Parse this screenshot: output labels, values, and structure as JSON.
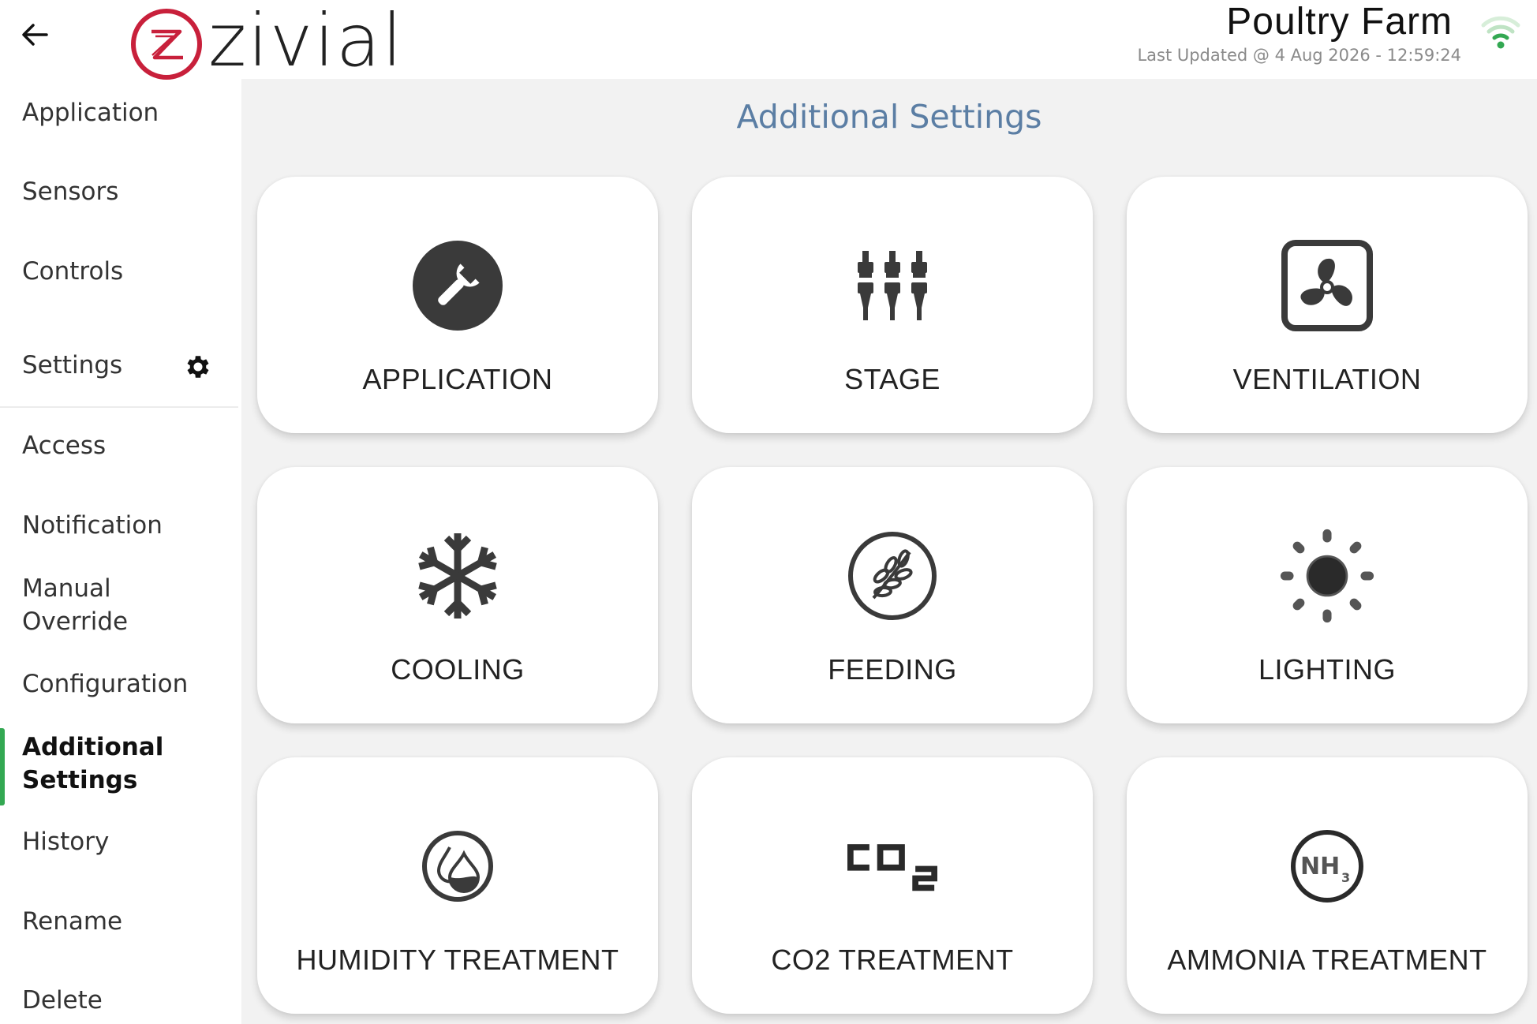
{
  "header": {
    "logo_text": "zivial",
    "title": "Poultry Farm",
    "last_updated": "Last Updated @ 4 Aug 2026 - 12:59:24"
  },
  "sidebar": {
    "items": [
      {
        "label": "Application"
      },
      {
        "label": "Sensors"
      },
      {
        "label": "Controls"
      },
      {
        "label": "Settings"
      },
      {
        "label": "Access"
      },
      {
        "label": "Notification"
      },
      {
        "label": "Manual\nOverride"
      },
      {
        "label": "Configuration"
      },
      {
        "label": "Additional\nSettings"
      },
      {
        "label": "History"
      },
      {
        "label": "Rename"
      },
      {
        "label": "Delete"
      }
    ],
    "active": "Additional Settings"
  },
  "main": {
    "title": "Additional Settings",
    "cards": [
      {
        "label": "APPLICATION",
        "icon": "wrench-icon"
      },
      {
        "label": "STAGE",
        "icon": "stage-icon"
      },
      {
        "label": "VENTILATION",
        "icon": "fan-icon"
      },
      {
        "label": "COOLING",
        "icon": "snowflake-icon"
      },
      {
        "label": "FEEDING",
        "icon": "grain-icon"
      },
      {
        "label": "LIGHTING",
        "icon": "sun-icon"
      },
      {
        "label": "HUMIDITY TREATMENT",
        "icon": "humidity-icon"
      },
      {
        "label": "CO2 TREATMENT",
        "icon": "co2-icon"
      },
      {
        "label": "AMMONIA TREATMENT",
        "icon": "ammonia-icon"
      }
    ]
  },
  "colors": {
    "accent": "#33a852",
    "title_blue": "#5b7ea4",
    "logo_red": "#c8203b",
    "icon_dark": "#3a3a3a",
    "main_bg": "#f2f2f2"
  }
}
